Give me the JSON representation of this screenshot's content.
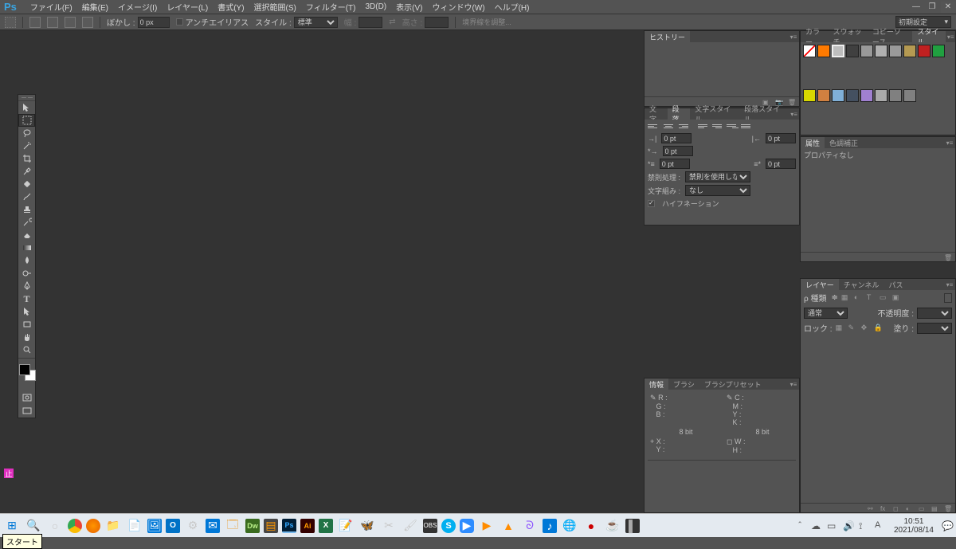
{
  "app": {
    "logo": "Ps"
  },
  "menu": [
    "ファイル(F)",
    "編集(E)",
    "イメージ(I)",
    "レイヤー(L)",
    "書式(Y)",
    "選択範囲(S)",
    "フィルター(T)",
    "3D(D)",
    "表示(V)",
    "ウィンドウ(W)",
    "ヘルプ(H)"
  ],
  "options": {
    "feather_lbl": "ぼかし :",
    "feather_val": "0 px",
    "anti_lbl": "アンチエイリアス",
    "style_lbl": "スタイル :",
    "style_val": "標準",
    "width_lbl": "幅 :",
    "width_val": "",
    "height_lbl": "高さ :",
    "height_val": "",
    "refine_lbl": "境界線を調整...",
    "workspace": "初期設定"
  },
  "tooltip": "スタート",
  "badge": "止",
  "history": {
    "tab": "ヒストリー"
  },
  "styles": {
    "tabs": [
      "カラー",
      "スウォッチ",
      "コピーソース",
      "スタイル"
    ],
    "swatches": [
      "#ffffff",
      "#ff7a00",
      "#bdbdbd",
      "#404040",
      "#999999",
      "#b0b0b0",
      "#9a9a9a",
      "#b59a52",
      "#c02020",
      "#20a040",
      "#d8d800",
      "#d08040",
      "#80b0d8",
      "#445060",
      "#a080d0",
      "#aaaaaa",
      "#808080",
      "#808080"
    ]
  },
  "properties": {
    "tabs": [
      "属性",
      "色調補正"
    ],
    "msg": "プロパティなし"
  },
  "text": {
    "tabs": [
      "文字",
      "段落",
      "文字スタイル",
      "段落スタイル"
    ],
    "indent_left": "0 pt",
    "indent_right": "0 pt",
    "indent_first": "0 pt",
    "space_before": "0 pt",
    "space_after": "0 pt",
    "kinsoku_lbl": "禁則処理 :",
    "kinsoku_val": "禁則を使用しない",
    "moji_lbl": "文字組み :",
    "moji_val": "なし",
    "hyphen": "ハイフネーション"
  },
  "info": {
    "tabs": [
      "情報",
      "ブラシ",
      "ブラシプリセット"
    ],
    "r": "R :",
    "g": "G :",
    "b": "B :",
    "c": "C :",
    "m": "M :",
    "y": "Y :",
    "k": "K :",
    "bit1": "8 bit",
    "bit2": "8 bit",
    "x": "X :",
    "ypos": "Y :",
    "w": "W :",
    "h": "H :"
  },
  "layers": {
    "tabs": [
      "レイヤー",
      "チャンネル",
      "パス"
    ],
    "kind_lbl": "ρ 種類",
    "mode_val": "通常",
    "opacity_lbl": "不透明度 :",
    "opacity_val": "",
    "lock_lbl": "ロック :",
    "fill_lbl": "塗り :",
    "fill_val": ""
  },
  "taskbar": {
    "time": "10:51",
    "date": "2021/08/14"
  }
}
